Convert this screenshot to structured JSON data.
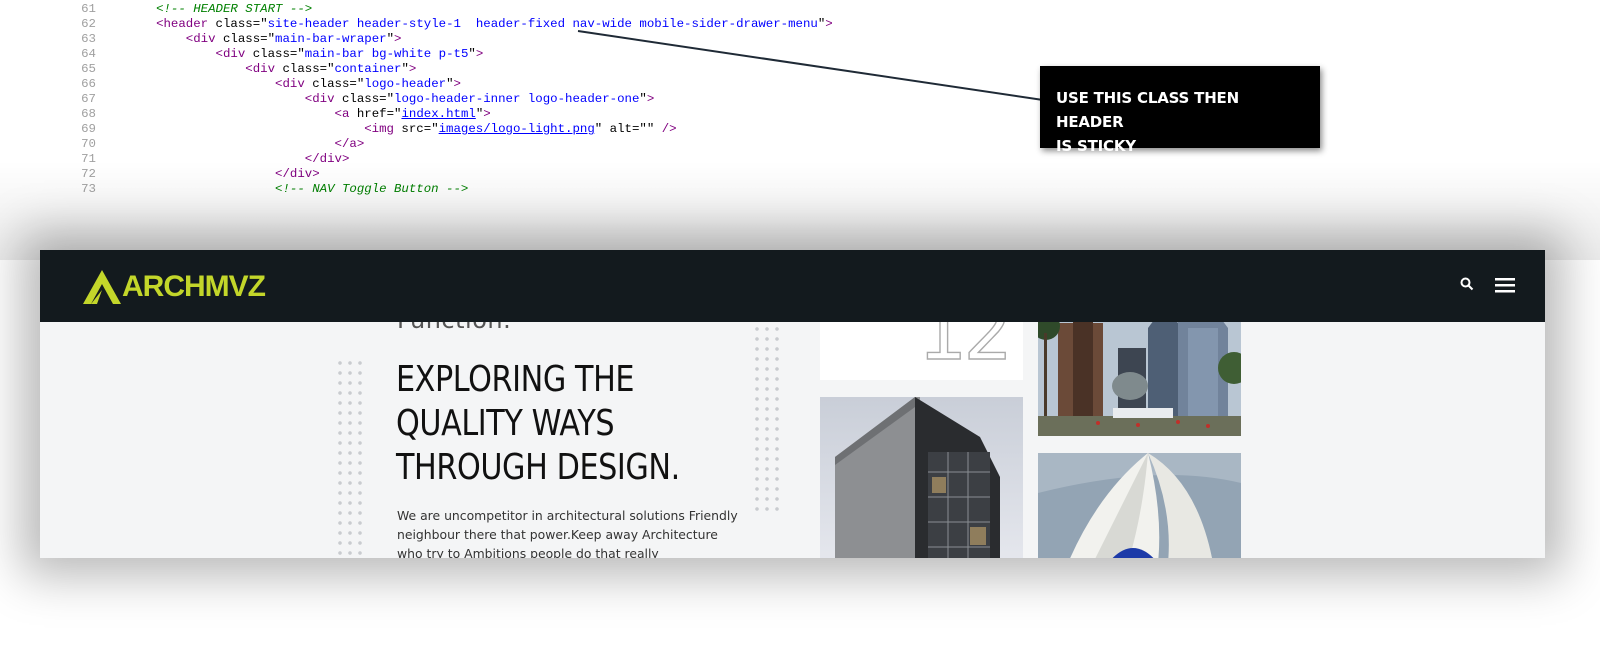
{
  "code": {
    "lines": [
      {
        "num": "61",
        "indent": "       ",
        "tokens": [
          {
            "c": "cmt",
            "t": "<!-- HEADER START -->"
          }
        ]
      },
      {
        "num": "62",
        "indent": "       ",
        "tokens": [
          {
            "c": "tag",
            "t": "<header"
          },
          {
            "c": "attr",
            "t": " class="
          },
          {
            "c": "txt",
            "t": "\""
          },
          {
            "c": "val",
            "t": "site-header header-style-1  header-fixed nav-wide mobile-sider-drawer-menu"
          },
          {
            "c": "txt",
            "t": "\""
          },
          {
            "c": "tag",
            "t": ">"
          }
        ]
      },
      {
        "num": "63",
        "indent": "           ",
        "tokens": [
          {
            "c": "tag",
            "t": "<div"
          },
          {
            "c": "attr",
            "t": " class="
          },
          {
            "c": "txt",
            "t": "\""
          },
          {
            "c": "val",
            "t": "main-bar-wraper"
          },
          {
            "c": "txt",
            "t": "\""
          },
          {
            "c": "tag",
            "t": ">"
          }
        ]
      },
      {
        "num": "64",
        "indent": "               ",
        "tokens": [
          {
            "c": "tag",
            "t": "<div"
          },
          {
            "c": "attr",
            "t": " class="
          },
          {
            "c": "txt",
            "t": "\""
          },
          {
            "c": "val",
            "t": "main-bar bg-white p-t5"
          },
          {
            "c": "txt",
            "t": "\""
          },
          {
            "c": "tag",
            "t": ">"
          }
        ]
      },
      {
        "num": "65",
        "indent": "                   ",
        "tokens": [
          {
            "c": "tag",
            "t": "<div"
          },
          {
            "c": "attr",
            "t": " class="
          },
          {
            "c": "txt",
            "t": "\""
          },
          {
            "c": "val",
            "t": "container"
          },
          {
            "c": "txt",
            "t": "\""
          },
          {
            "c": "tag",
            "t": ">"
          }
        ]
      },
      {
        "num": "66",
        "indent": "                       ",
        "tokens": [
          {
            "c": "tag",
            "t": "<div"
          },
          {
            "c": "attr",
            "t": " class="
          },
          {
            "c": "txt",
            "t": "\""
          },
          {
            "c": "val",
            "t": "logo-header"
          },
          {
            "c": "txt",
            "t": "\""
          },
          {
            "c": "tag",
            "t": ">"
          }
        ]
      },
      {
        "num": "67",
        "indent": "                           ",
        "tokens": [
          {
            "c": "tag",
            "t": "<div"
          },
          {
            "c": "attr",
            "t": " class="
          },
          {
            "c": "txt",
            "t": "\""
          },
          {
            "c": "val",
            "t": "logo-header-inner logo-header-one"
          },
          {
            "c": "txt",
            "t": "\""
          },
          {
            "c": "tag",
            "t": ">"
          }
        ]
      },
      {
        "num": "68",
        "indent": "                               ",
        "tokens": [
          {
            "c": "tag",
            "t": "<a"
          },
          {
            "c": "attr",
            "t": " href="
          },
          {
            "c": "txt",
            "t": "\""
          },
          {
            "c": "lnk",
            "t": "index.html"
          },
          {
            "c": "txt",
            "t": "\""
          },
          {
            "c": "tag",
            "t": ">"
          }
        ]
      },
      {
        "num": "69",
        "indent": "                                   ",
        "tokens": [
          {
            "c": "tag",
            "t": "<img"
          },
          {
            "c": "attr",
            "t": " src="
          },
          {
            "c": "txt",
            "t": "\""
          },
          {
            "c": "lnk",
            "t": "images/logo-light.png"
          },
          {
            "c": "txt",
            "t": "\""
          },
          {
            "c": "attr",
            "t": " alt="
          },
          {
            "c": "txt",
            "t": "\"\""
          },
          {
            "c": "tag",
            "t": " />"
          }
        ]
      },
      {
        "num": "70",
        "indent": "                               ",
        "tokens": [
          {
            "c": "tag",
            "t": "</a>"
          }
        ]
      },
      {
        "num": "71",
        "indent": "                           ",
        "tokens": [
          {
            "c": "tag",
            "t": "</div>"
          }
        ]
      },
      {
        "num": "72",
        "indent": "                       ",
        "tokens": [
          {
            "c": "tag",
            "t": "</div>"
          }
        ]
      },
      {
        "num": "73",
        "indent": "                       ",
        "tokens": [
          {
            "c": "cmt",
            "t": "<!-- NAV Toggle Button -->"
          }
        ]
      }
    ]
  },
  "callout": {
    "line1": "USE THIS CLASS THEN HEADER",
    "line2": "IS STICKY"
  },
  "site": {
    "logo_text": "ARCHMVZ",
    "colors": {
      "header_bg": "#131a1e",
      "brand": "#c3d62a",
      "page_bg": "#f4f5f6"
    },
    "icons": {
      "search": "search-icon",
      "menu": "hamburger-menu-icon"
    },
    "function_text": "Function.",
    "headline": [
      "EXPLORING THE",
      "QUALITY WAYS",
      "THROUGH DESIGN."
    ],
    "paragraph": [
      "We are uncompetitor in architectural solutions Friendly",
      "neighbour there that power.Keep away Architecture",
      "who try to Ambitions people do that really"
    ],
    "card_number": "12"
  }
}
